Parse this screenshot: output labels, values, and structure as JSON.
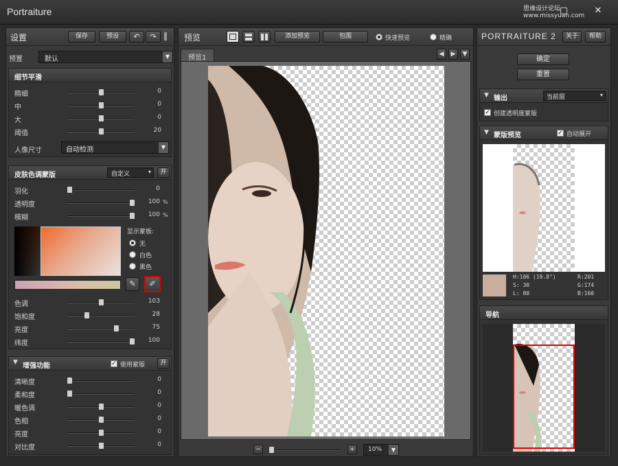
{
  "window": {
    "title": "Portraiture",
    "watermark": "思缘设计论坛 www.missyuan.com"
  },
  "settings": {
    "title": "设置",
    "save": "保存",
    "preset": "预设",
    "undo": "↶",
    "redo": "↷",
    "preset_label": "预置",
    "preset_value": "默认",
    "detail": {
      "title": "细节平滑",
      "rows": [
        {
          "label": "精细",
          "value": "0",
          "pos": 0.5
        },
        {
          "label": "中",
          "value": "0",
          "pos": 0.5
        },
        {
          "label": "大",
          "value": "0",
          "pos": 0.5
        },
        {
          "label": "阈值",
          "value": "20",
          "pos": 0.5
        }
      ],
      "portrait_label": "人像尺寸",
      "portrait_value": "自动检测"
    },
    "skin": {
      "title": "皮肤色调蒙版",
      "mode": "自定义",
      "toggle": "开",
      "rows": [
        {
          "label": "羽化",
          "value": "0",
          "unit": "",
          "pos": 0.0
        },
        {
          "label": "透明度",
          "value": "100",
          "unit": "%",
          "pos": 1.0
        },
        {
          "label": "模糊",
          "value": "100",
          "unit": "%",
          "pos": 1.0
        }
      ],
      "show_mask_label": "显示蒙板:",
      "mask_options": [
        "无",
        "白色",
        "黑色"
      ],
      "rows2": [
        {
          "label": "色调",
          "value": "103",
          "pos": 0.5
        },
        {
          "label": "饱和度",
          "value": "28",
          "pos": 0.28
        },
        {
          "label": "亮度",
          "value": "75",
          "pos": 0.75
        },
        {
          "label": "纬度",
          "value": "100",
          "pos": 1.0
        }
      ]
    },
    "enhance": {
      "title": "增强功能",
      "use_mask": "使用蒙版",
      "toggle": "开",
      "rows": [
        {
          "label": "清晰度",
          "value": "0",
          "pos": 0.0
        },
        {
          "label": "柔和度",
          "value": "0",
          "pos": 0.0
        },
        {
          "label": "暖色调",
          "value": "0",
          "pos": 0.5
        },
        {
          "label": "色相",
          "value": "0",
          "pos": 0.5
        },
        {
          "label": "亮度",
          "value": "0",
          "pos": 0.5
        },
        {
          "label": "对比度",
          "value": "0",
          "pos": 0.5
        }
      ]
    }
  },
  "preview": {
    "title": "预览",
    "add_preview": "添加预览",
    "bracket": "包围",
    "fast_preview": "快速预览",
    "accurate": "精确",
    "tab": "预览1",
    "zoom": "10%",
    "zoom_minus": "−",
    "zoom_plus": "+"
  },
  "right": {
    "brand": "PORTRAITURE 2",
    "about": "关于",
    "help": "帮助",
    "ok": "确定",
    "reset": "重置",
    "output": {
      "title": "输出",
      "value": "当前层",
      "checkbox": "创建透明度蒙版"
    },
    "mask_preview": {
      "title": "蒙版预览",
      "auto_expand": "自动展开",
      "info": {
        "h": "H:106 (19.8°)",
        "s": "S: 30",
        "l": "L: 80",
        "r": "R:201",
        "g": "G:174",
        "b": "B:160"
      },
      "swatch": "#c9aea0"
    },
    "nav": {
      "title": "导航"
    }
  }
}
